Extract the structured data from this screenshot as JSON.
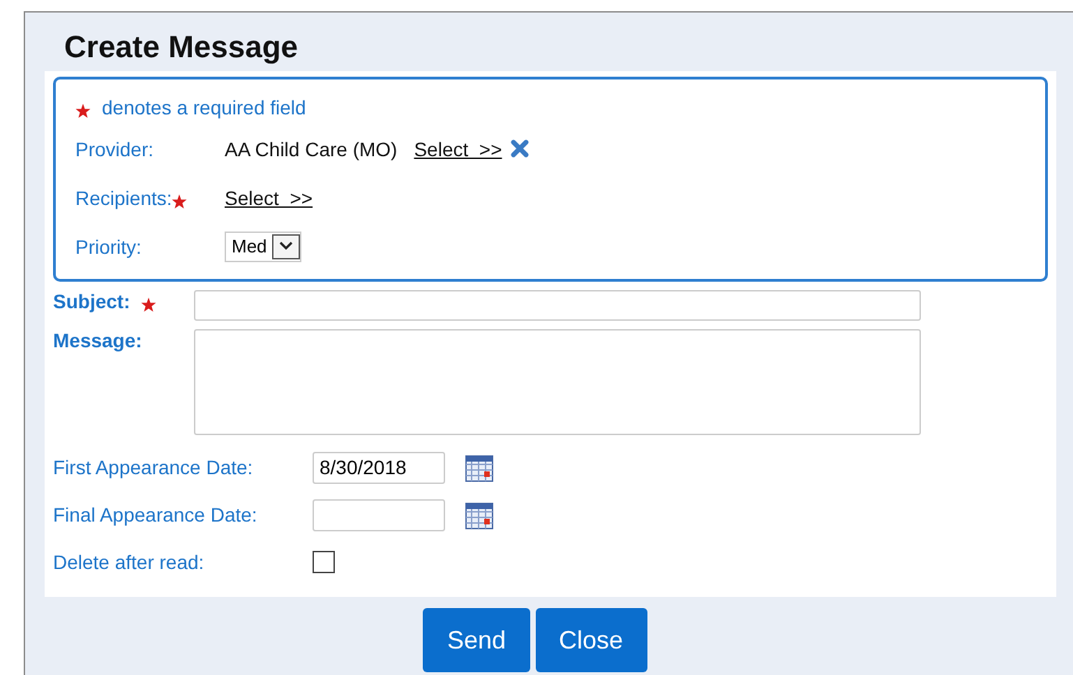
{
  "dialog": {
    "title": "Create Message"
  },
  "required_note": "denotes a required field",
  "header_fields": [
    {
      "kind": "text-select",
      "label": "Provider:",
      "required": false,
      "value": "AA Child Care (MO)",
      "link": "Select  >>",
      "removable": true
    },
    {
      "kind": "select-link",
      "label": "Recipients:",
      "required": true,
      "link": "Select  >>"
    },
    {
      "kind": "dropdown",
      "label": "Priority:",
      "required": false,
      "value": "Med"
    }
  ],
  "subject": {
    "label": "Subject:",
    "required": true
  },
  "message": {
    "label": "Message:"
  },
  "dates": [
    {
      "label": "First Appearance Date:",
      "value": "8/30/2018"
    },
    {
      "label": "Final Appearance Date:"
    }
  ],
  "delete_after_read": {
    "label": "Delete after read:",
    "checked": false
  },
  "buttons": [
    "Send",
    "Close"
  ]
}
